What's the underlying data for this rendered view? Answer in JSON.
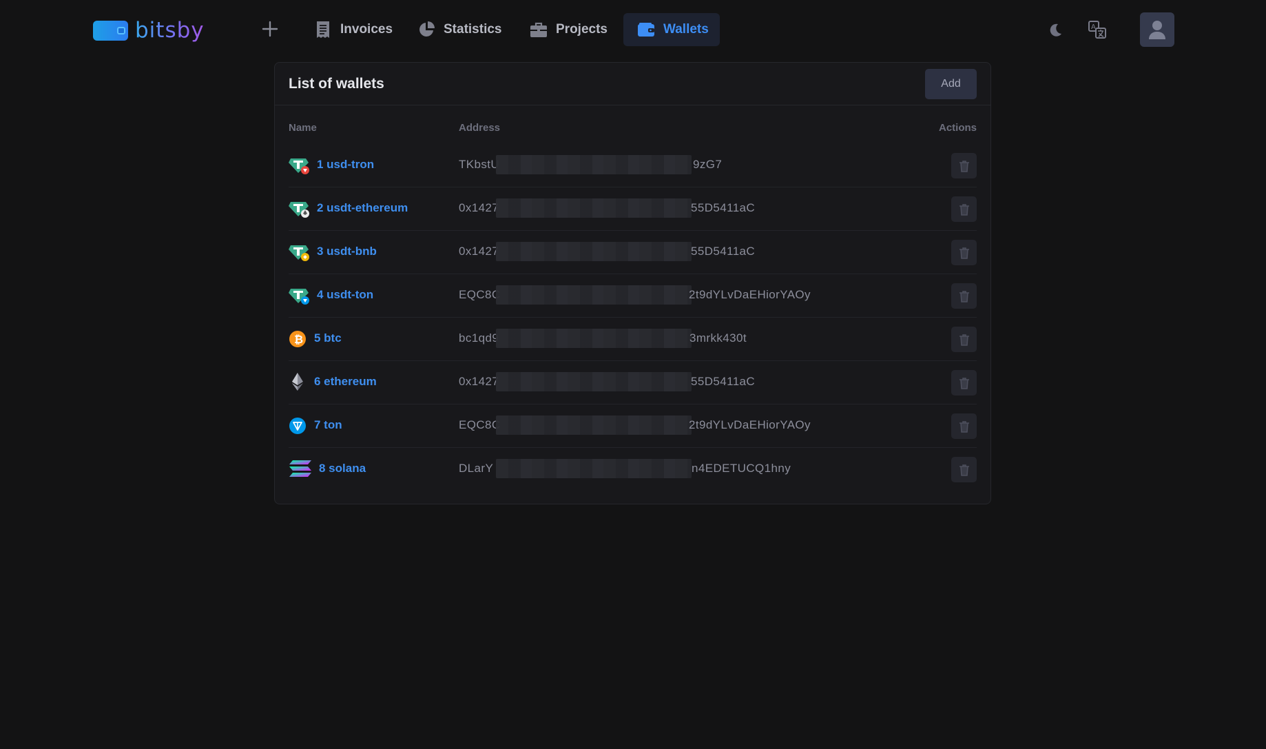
{
  "brand": {
    "name": "bitsby"
  },
  "nav": {
    "items": [
      {
        "label": "Invoices",
        "icon": "receipt-icon"
      },
      {
        "label": "Statistics",
        "icon": "pie-chart-icon"
      },
      {
        "label": "Projects",
        "icon": "briefcase-icon"
      },
      {
        "label": "Wallets",
        "icon": "wallet-icon",
        "active": true
      }
    ]
  },
  "card": {
    "title": "List of wallets",
    "add_label": "Add",
    "columns": {
      "name": "Name",
      "address": "Address",
      "actions": "Actions"
    }
  },
  "wallets": [
    {
      "name": "1 usd-tron",
      "address_start": "TKbstU",
      "address_end": "9zG7",
      "icon": "tether-tron-icon"
    },
    {
      "name": "2 usdt-ethereum",
      "address_start": "0x1427",
      "address_end": "55D5411aC",
      "icon": "tether-ethereum-icon"
    },
    {
      "name": "3 usdt-bnb",
      "address_start": "0x1427",
      "address_end": "55D5411aC",
      "icon": "tether-bnb-icon"
    },
    {
      "name": "4 usdt-ton",
      "address_start": "EQC8C",
      "address_end": "2t9dYLvDaEHiorYAOy",
      "icon": "tether-ton-icon"
    },
    {
      "name": "5 btc",
      "address_start": "bc1qd9",
      "address_end": "3mrkk430t",
      "icon": "bitcoin-icon"
    },
    {
      "name": "6 ethereum",
      "address_start": "0x1427",
      "address_end": "55D5411aC",
      "icon": "ethereum-icon"
    },
    {
      "name": "7 ton",
      "address_start": "EQC8C",
      "address_end": "2t9dYLvDaEHiorYAOy",
      "icon": "ton-icon"
    },
    {
      "name": "8 solana",
      "address_start": "DLarY",
      "address_end": "n4EDETUCQ1hny",
      "icon": "solana-icon"
    }
  ],
  "colors": {
    "background": "#131314",
    "card": "#18181b",
    "accent": "#3d8ef5",
    "nav_active_bg": "#1d2230"
  }
}
